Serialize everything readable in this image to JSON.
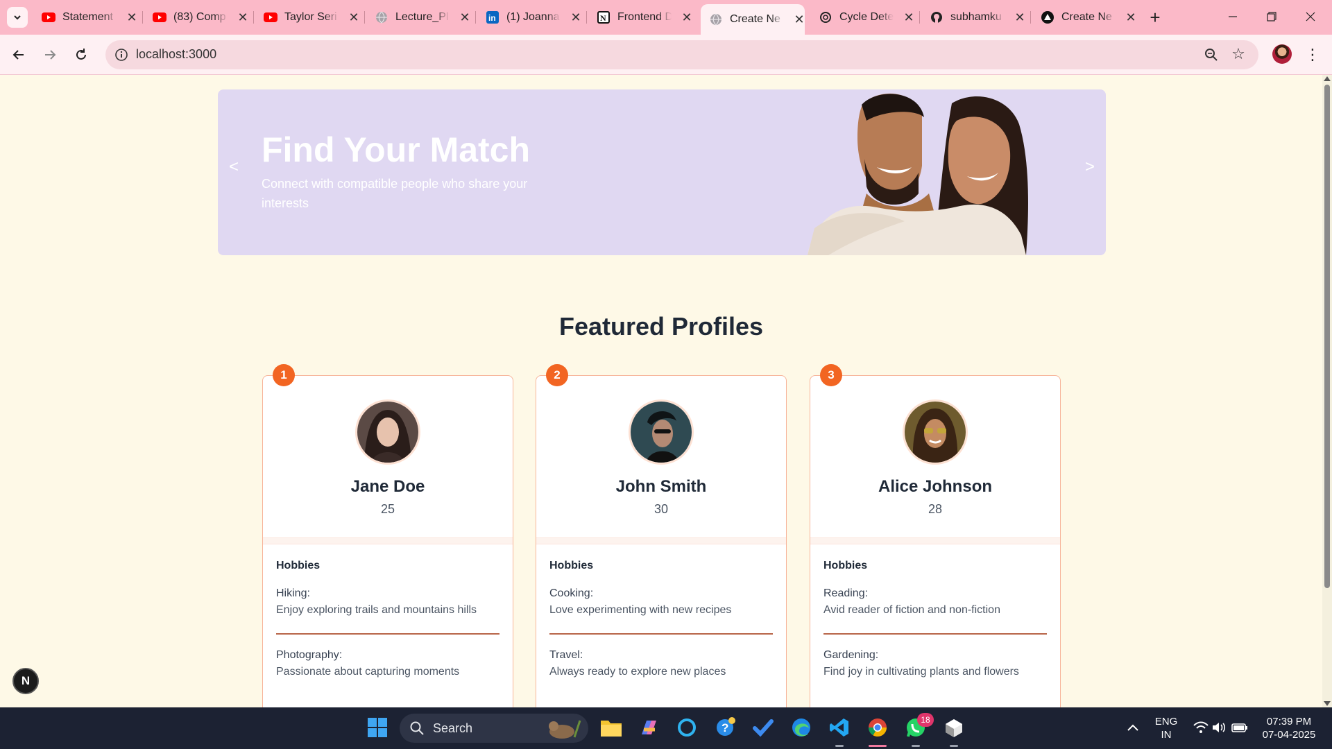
{
  "browser": {
    "tabs": [
      {
        "title": "Statement",
        "icon": "youtube-icon"
      },
      {
        "title": "(83) Comp",
        "icon": "youtube-icon"
      },
      {
        "title": "Taylor Seri",
        "icon": "youtube-icon"
      },
      {
        "title": "Lecture_Pl",
        "icon": "globe-icon"
      },
      {
        "title": "(1) Joanna",
        "icon": "linkedin-icon"
      },
      {
        "title": "Frontend D",
        "icon": "notion-icon"
      },
      {
        "title": "Create Ne",
        "icon": "globe-icon",
        "active": true
      },
      {
        "title": "Cycle Dete",
        "icon": "chatgpt-icon"
      },
      {
        "title": "subhamku",
        "icon": "github-icon"
      },
      {
        "title": "Create Ne",
        "icon": "vercel-icon"
      }
    ],
    "tab_close_glyph": "✕",
    "new_tab_glyph": "+",
    "url": "localhost:3000",
    "colors": {
      "tab_strip": "#fbb9c8",
      "toolbar": "#fef0f3"
    }
  },
  "hero": {
    "title": "Find Your Match",
    "subtitle": "Connect with compatible people who share your interests",
    "prev_label": "<",
    "next_label": ">",
    "background": "#e0d8f2"
  },
  "featured": {
    "title": "Featured Profiles",
    "hobbies_heading": "Hobbies",
    "profiles": [
      {
        "rank": "1",
        "name": "Jane Doe",
        "age": "25",
        "hobbies": [
          {
            "name": "Hiking:",
            "desc": "Enjoy exploring trails and mountains hills"
          },
          {
            "name": "Photography:",
            "desc": "Passionate about capturing moments"
          }
        ]
      },
      {
        "rank": "2",
        "name": "John Smith",
        "age": "30",
        "hobbies": [
          {
            "name": "Cooking:",
            "desc": "Love experimenting with new recipes"
          },
          {
            "name": "Travel:",
            "desc": "Always ready to explore new places"
          }
        ]
      },
      {
        "rank": "3",
        "name": "Alice Johnson",
        "age": "28",
        "hobbies": [
          {
            "name": "Reading:",
            "desc": "Avid reader of fiction and non-fiction"
          },
          {
            "name": "Gardening:",
            "desc": "Find joy in cultivating plants and flowers"
          }
        ]
      }
    ],
    "accent": "#f26522"
  },
  "dev_badge": "N",
  "taskbar": {
    "search_label": "Search",
    "language": "ENG",
    "region": "IN",
    "time": "07:39 PM",
    "date": "07-04-2025",
    "whatsapp_badge": "18"
  }
}
